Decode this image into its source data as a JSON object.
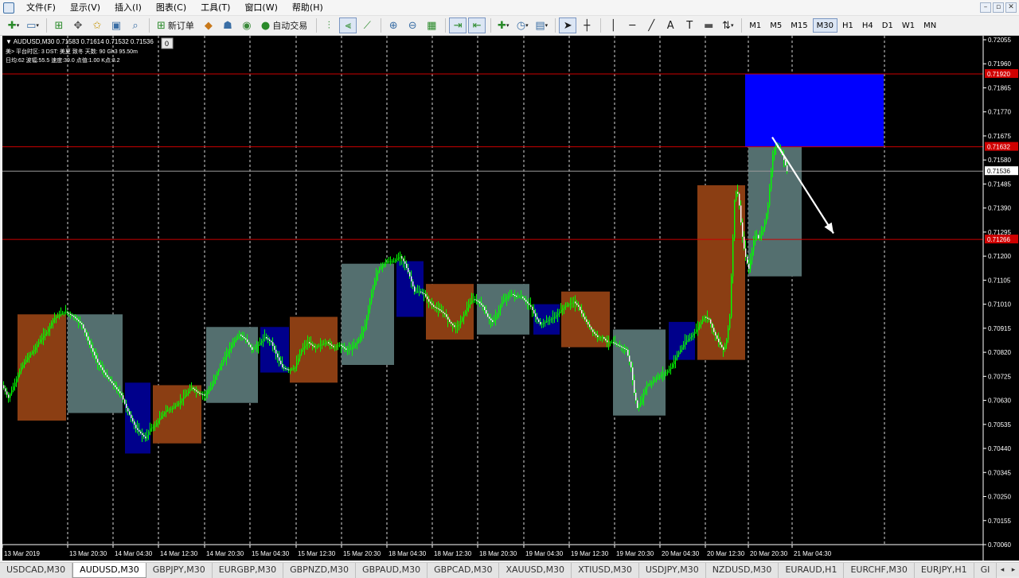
{
  "menubar": {
    "items": [
      "文件(F)",
      "显示(V)",
      "插入(I)",
      "图表(C)",
      "工具(T)",
      "窗口(W)",
      "帮助(H)"
    ]
  },
  "toolbar": {
    "new_order_label": "新订单",
    "autotrading_label": "自动交易",
    "timeframes": [
      "M1",
      "M5",
      "M15",
      "M30",
      "H1",
      "H4",
      "D1",
      "W1",
      "MN"
    ],
    "active_timeframe": "M30"
  },
  "chart": {
    "header": {
      "symbol_line": "▼ AUDUSD,M30  0.71583 0.71614 0.71532 0.71536",
      "info_line_1": "美> 平台时区: 3  DST: 美夏 致冬  天数:  90  Gh3  95.50m",
      "info_line_2": "日均:62  波幅:55.5  速度:39.0  点值:1.00  K点:8.2",
      "badge": "0"
    },
    "colors": {
      "background": "#000000",
      "up_candle": "#00ff00",
      "grid": "#ffffff",
      "level_line": "#cc0000",
      "bid_line": "#9a9a9a",
      "box_brown": "#8b3e13",
      "box_slate": "#546f6f",
      "box_navy": "#00008b",
      "box_blue": "#0000ff",
      "arrow": "#ffffff"
    }
  },
  "chart_data": {
    "type": "candlestick",
    "symbol": "AUDUSD",
    "timeframe": "M30",
    "y_axis": {
      "min": 0.7006,
      "max": 0.72055,
      "ticks": [
        "0.72055",
        "0.71960",
        "0.71865",
        "0.71770",
        "0.71675",
        "0.71580",
        "0.71485",
        "0.71390",
        "0.71295",
        "0.71200",
        "0.71105",
        "0.71010",
        "0.70915",
        "0.70820",
        "0.70725",
        "0.70630",
        "0.70535",
        "0.70440",
        "0.70345",
        "0.70250",
        "0.70155",
        "0.70060"
      ]
    },
    "x_axis": {
      "ticks": [
        "13 Mar 2019",
        "13 Mar 20:30",
        "14 Mar 04:30",
        "14 Mar 12:30",
        "14 Mar 20:30",
        "15 Mar 04:30",
        "15 Mar 12:30",
        "15 Mar 20:30",
        "18 Mar 04:30",
        "18 Mar 12:30",
        "18 Mar 20:30",
        "19 Mar 04:30",
        "19 Mar 12:30",
        "19 Mar 20:30",
        "20 Mar 04:30",
        "20 Mar 12:30",
        "20 Mar 20:30",
        "21 Mar 04:30"
      ]
    },
    "price_labels": [
      {
        "price": 0.7192,
        "label": "0.71920",
        "kind": "level"
      },
      {
        "price": 0.71632,
        "label": "0.71632",
        "kind": "level"
      },
      {
        "price": 0.71536,
        "label": "0.71536",
        "kind": "bid"
      },
      {
        "price": 0.71266,
        "label": "0.71266",
        "kind": "level"
      }
    ],
    "price_path": [
      [
        0,
        0.7069
      ],
      [
        8,
        0.7064
      ],
      [
        16,
        0.707
      ],
      [
        24,
        0.7076
      ],
      [
        32,
        0.708
      ],
      [
        40,
        0.7083
      ],
      [
        48,
        0.7087
      ],
      [
        56,
        0.709
      ],
      [
        64,
        0.7095
      ],
      [
        72,
        0.7097
      ],
      [
        80,
        0.7098
      ],
      [
        90,
        0.7096
      ],
      [
        100,
        0.7093
      ],
      [
        110,
        0.7085
      ],
      [
        120,
        0.7078
      ],
      [
        130,
        0.7073
      ],
      [
        140,
        0.7069
      ],
      [
        150,
        0.7065
      ],
      [
        156,
        0.706
      ],
      [
        162,
        0.7056
      ],
      [
        168,
        0.7052
      ],
      [
        174,
        0.705
      ],
      [
        180,
        0.7048
      ],
      [
        186,
        0.7052
      ],
      [
        192,
        0.7053
      ],
      [
        198,
        0.7056
      ],
      [
        206,
        0.7059
      ],
      [
        214,
        0.706
      ],
      [
        222,
        0.7062
      ],
      [
        230,
        0.7065
      ],
      [
        238,
        0.7068
      ],
      [
        246,
        0.7066
      ],
      [
        254,
        0.7065
      ],
      [
        262,
        0.7068
      ],
      [
        270,
        0.7074
      ],
      [
        280,
        0.708
      ],
      [
        290,
        0.7086
      ],
      [
        298,
        0.7089
      ],
      [
        306,
        0.7087
      ],
      [
        314,
        0.7083
      ],
      [
        322,
        0.7085
      ],
      [
        330,
        0.7088
      ],
      [
        338,
        0.7086
      ],
      [
        346,
        0.708
      ],
      [
        352,
        0.7076
      ],
      [
        360,
        0.7075
      ],
      [
        368,
        0.7076
      ],
      [
        376,
        0.7083
      ],
      [
        384,
        0.7086
      ],
      [
        392,
        0.7084
      ],
      [
        400,
        0.7085
      ],
      [
        408,
        0.7086
      ],
      [
        416,
        0.7084
      ],
      [
        424,
        0.7085
      ],
      [
        432,
        0.7083
      ],
      [
        440,
        0.7084
      ],
      [
        448,
        0.7087
      ],
      [
        456,
        0.7093
      ],
      [
        464,
        0.7105
      ],
      [
        470,
        0.7113
      ],
      [
        476,
        0.7116
      ],
      [
        484,
        0.7118
      ],
      [
        492,
        0.7118
      ],
      [
        500,
        0.712
      ],
      [
        506,
        0.7117
      ],
      [
        512,
        0.7112
      ],
      [
        518,
        0.7106
      ],
      [
        524,
        0.7106
      ],
      [
        530,
        0.7105
      ],
      [
        536,
        0.7102
      ],
      [
        542,
        0.71
      ],
      [
        548,
        0.7099
      ],
      [
        556,
        0.7097
      ],
      [
        562,
        0.7094
      ],
      [
        568,
        0.7092
      ],
      [
        574,
        0.7093
      ],
      [
        580,
        0.7097
      ],
      [
        586,
        0.7101
      ],
      [
        592,
        0.7103
      ],
      [
        598,
        0.7102
      ],
      [
        604,
        0.71
      ],
      [
        610,
        0.7096
      ],
      [
        616,
        0.7094
      ],
      [
        622,
        0.7097
      ],
      [
        628,
        0.7102
      ],
      [
        634,
        0.7104
      ],
      [
        640,
        0.7105
      ],
      [
        646,
        0.7104
      ],
      [
        652,
        0.7104
      ],
      [
        658,
        0.7102
      ],
      [
        664,
        0.71
      ],
      [
        670,
        0.7096
      ],
      [
        676,
        0.7093
      ],
      [
        682,
        0.7094
      ],
      [
        688,
        0.7095
      ],
      [
        694,
        0.7096
      ],
      [
        700,
        0.7098
      ],
      [
        706,
        0.71
      ],
      [
        712,
        0.7101
      ],
      [
        718,
        0.7102
      ],
      [
        724,
        0.71
      ],
      [
        730,
        0.7096
      ],
      [
        736,
        0.7093
      ],
      [
        742,
        0.709
      ],
      [
        748,
        0.7088
      ],
      [
        754,
        0.7088
      ],
      [
        760,
        0.7086
      ],
      [
        766,
        0.7086
      ],
      [
        772,
        0.7085
      ],
      [
        778,
        0.7084
      ],
      [
        784,
        0.7083
      ],
      [
        790,
        0.7076
      ],
      [
        794,
        0.7066
      ],
      [
        798,
        0.706
      ],
      [
        802,
        0.7062
      ],
      [
        806,
        0.7066
      ],
      [
        810,
        0.7069
      ],
      [
        816,
        0.707
      ],
      [
        822,
        0.7072
      ],
      [
        828,
        0.7073
      ],
      [
        834,
        0.7074
      ],
      [
        840,
        0.7076
      ],
      [
        846,
        0.708
      ],
      [
        852,
        0.7083
      ],
      [
        858,
        0.7086
      ],
      [
        864,
        0.7088
      ],
      [
        870,
        0.709
      ],
      [
        876,
        0.7093
      ],
      [
        882,
        0.7096
      ],
      [
        888,
        0.7095
      ],
      [
        894,
        0.709
      ],
      [
        900,
        0.7086
      ],
      [
        906,
        0.7083
      ],
      [
        910,
        0.7087
      ],
      [
        914,
        0.7096
      ],
      [
        917,
        0.712
      ],
      [
        920,
        0.7142
      ],
      [
        923,
        0.7147
      ],
      [
        926,
        0.714
      ],
      [
        929,
        0.713
      ],
      [
        932,
        0.7123
      ],
      [
        935,
        0.7118
      ],
      [
        938,
        0.7115
      ],
      [
        941,
        0.712
      ],
      [
        944,
        0.7126
      ],
      [
        947,
        0.7129
      ],
      [
        950,
        0.7127
      ],
      [
        953,
        0.7129
      ],
      [
        956,
        0.7131
      ],
      [
        959,
        0.7135
      ],
      [
        962,
        0.714
      ],
      [
        965,
        0.715
      ],
      [
        968,
        0.716
      ],
      [
        971,
        0.7164
      ],
      [
        974,
        0.7163
      ],
      [
        977,
        0.7162
      ],
      [
        980,
        0.716
      ],
      [
        983,
        0.7157
      ],
      [
        986,
        0.71536
      ]
    ],
    "zones": [
      {
        "x": [
          19,
          80
        ],
        "top": 0.7097,
        "bottom": 0.7055,
        "color": "brown"
      },
      {
        "x": [
          82,
          151
        ],
        "top": 0.7097,
        "bottom": 0.7058,
        "color": "slate"
      },
      {
        "x": [
          154,
          186
        ],
        "top": 0.707,
        "bottom": 0.7042,
        "color": "navy"
      },
      {
        "x": [
          189,
          250
        ],
        "top": 0.7069,
        "bottom": 0.7046,
        "color": "brown"
      },
      {
        "x": [
          256,
          321
        ],
        "top": 0.7092,
        "bottom": 0.7062,
        "color": "slate"
      },
      {
        "x": [
          324,
          360
        ],
        "top": 0.7092,
        "bottom": 0.7074,
        "color": "navy"
      },
      {
        "x": [
          361,
          421
        ],
        "top": 0.7096,
        "bottom": 0.707,
        "color": "brown"
      },
      {
        "x": [
          426,
          492
        ],
        "top": 0.7117,
        "bottom": 0.7077,
        "color": "slate"
      },
      {
        "x": [
          495,
          529
        ],
        "top": 0.7118,
        "bottom": 0.7096,
        "color": "navy"
      },
      {
        "x": [
          532,
          592
        ],
        "top": 0.7109,
        "bottom": 0.7087,
        "color": "brown"
      },
      {
        "x": [
          596,
          662
        ],
        "top": 0.7109,
        "bottom": 0.7089,
        "color": "slate"
      },
      {
        "x": [
          667,
          700
        ],
        "top": 0.7101,
        "bottom": 0.7089,
        "color": "navy"
      },
      {
        "x": [
          702,
          763
        ],
        "top": 0.7106,
        "bottom": 0.7084,
        "color": "brown"
      },
      {
        "x": [
          767,
          833
        ],
        "top": 0.7091,
        "bottom": 0.7057,
        "color": "slate"
      },
      {
        "x": [
          837,
          870
        ],
        "top": 0.7094,
        "bottom": 0.7079,
        "color": "navy"
      },
      {
        "x": [
          873,
          933
        ],
        "top": 0.7148,
        "bottom": 0.7079,
        "color": "brown"
      },
      {
        "x": [
          937,
          1004
        ],
        "top": 0.7167,
        "bottom": 0.7112,
        "color": "slate"
      },
      {
        "x": [
          933,
          1107
        ],
        "top": 0.7192,
        "bottom": 0.71632,
        "color": "blue"
      }
    ],
    "annotations": [
      {
        "type": "arrow",
        "from": [
          967,
          0.7167
        ],
        "to": [
          1044,
          0.7129
        ]
      }
    ],
    "gridlines": "vertical dashed",
    "legend": "none"
  },
  "bottom_tabs": {
    "items": [
      "USDCAD,M30",
      "AUDUSD,M30",
      "GBPJPY,M30",
      "EURGBP,M30",
      "GBPNZD,M30",
      "GBPAUD,M30",
      "GBPCAD,M30",
      "XAUUSD,M30",
      "XTIUSD,M30",
      "USDJPY,M30",
      "NZDUSD,M30",
      "EURAUD,H1",
      "EURCHF,M30",
      "EURJPY,H1",
      "GI"
    ],
    "active": "AUDUSD,M30"
  }
}
